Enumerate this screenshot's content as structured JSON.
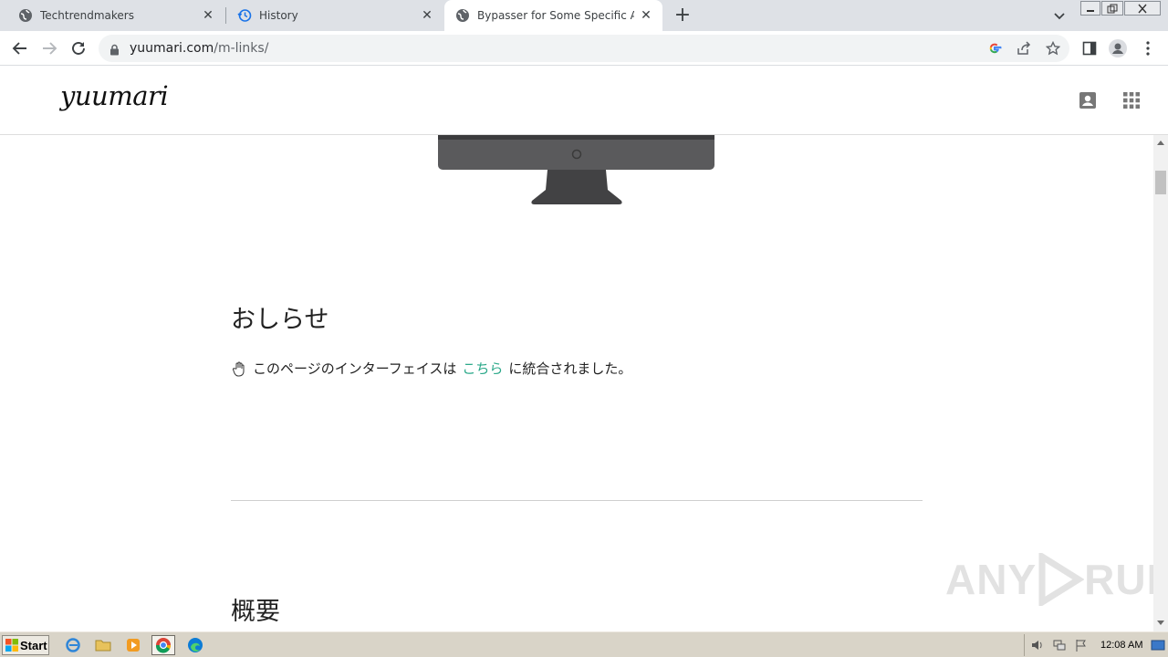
{
  "browser": {
    "tabs": [
      {
        "title": "Techtrendmakers",
        "active": false
      },
      {
        "title": "History",
        "active": false
      },
      {
        "title": "Bypasser for Some Specific Ad-Links",
        "active": true
      }
    ],
    "url_host": "yuumari.com",
    "url_path": "/m-links/"
  },
  "site": {
    "logo": "yuumari"
  },
  "main": {
    "notice_title": "おしらせ",
    "notice_before": "このページのインターフェイスは",
    "notice_link": "こちら",
    "notice_after": "に統合されました。",
    "overview_title": "概要"
  },
  "watermark": {
    "left": "ANY",
    "right": "RUN"
  },
  "taskbar": {
    "start_label": "Start",
    "clock": "12:08 AM"
  },
  "colors": {
    "link": "#2aa889",
    "tabstrip": "#dee1e6",
    "taskbar": "#d9d4c8"
  }
}
